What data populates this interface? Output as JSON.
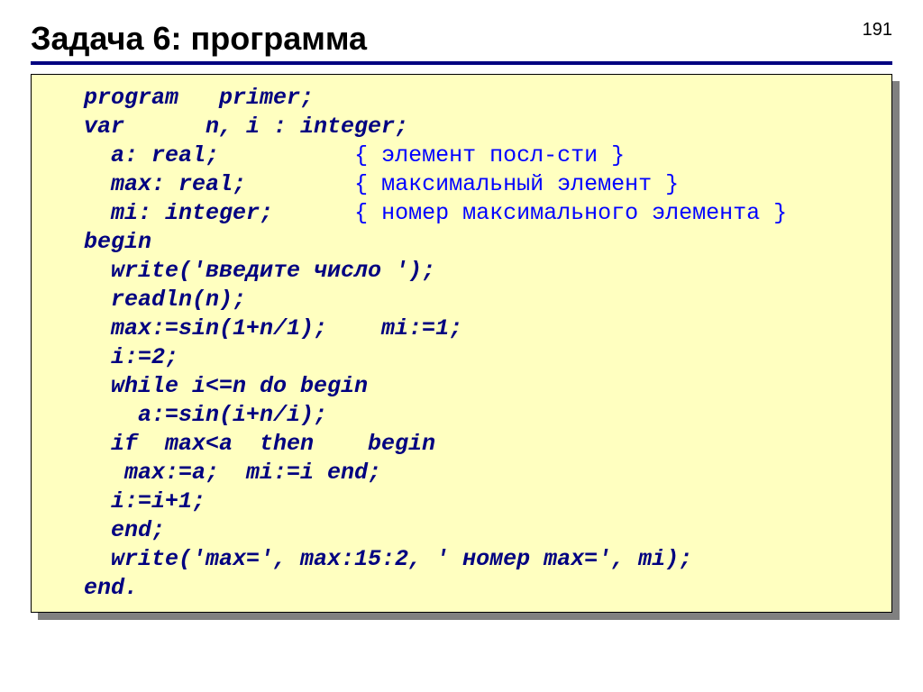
{
  "pageNumber": "191",
  "title": "Задача 6: программа",
  "code": {
    "l1": "program   primer;",
    "l2": "var      n, i : integer;",
    "l3a": "  a: real;",
    "l3c": "{ элемент посл-сти }",
    "l4a": "  max: real;",
    "l4c": "{ максимальный элемент }",
    "l5a": "  mi: integer;",
    "l5c": "{ номер максимального элемента }",
    "l6": "begin",
    "l7": "  write('введите число ');",
    "l8": "  readln(n);",
    "l9": "  max:=sin(1+n/1);    mi:=1;",
    "l10": "  i:=2;",
    "l11": "  while i<=n do begin",
    "l12": "    a:=sin(i+n/i);",
    "l13": "  if  max<a  then    begin",
    "l14": "   max:=a;  mi:=i end;",
    "l15": "  i:=i+1;",
    "l16": "  end;",
    "l17": "  write('max=', max:15:2, ' номер max=', mi);",
    "l18": "end."
  }
}
